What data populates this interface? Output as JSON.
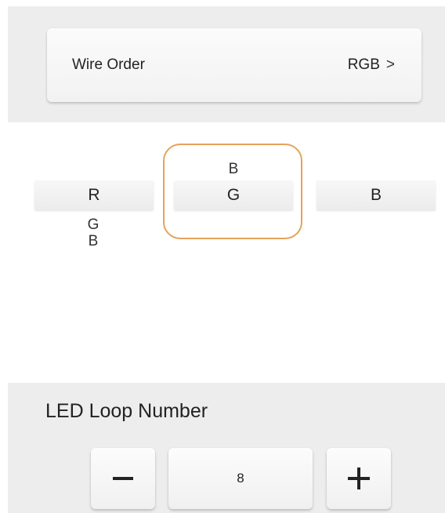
{
  "wire_order": {
    "label": "Wire Order",
    "value": "RGB",
    "chevron": ">"
  },
  "picker": {
    "left": {
      "selected": "R",
      "below": [
        "G",
        "B"
      ]
    },
    "middle": {
      "above": "B",
      "selected": "G"
    },
    "right": {
      "selected": "B"
    },
    "highlight_color": "#e6a25a"
  },
  "led_loop": {
    "title": "LED Loop Number",
    "value": "8",
    "minus_icon": "minus-icon",
    "plus_icon": "plus-icon"
  }
}
